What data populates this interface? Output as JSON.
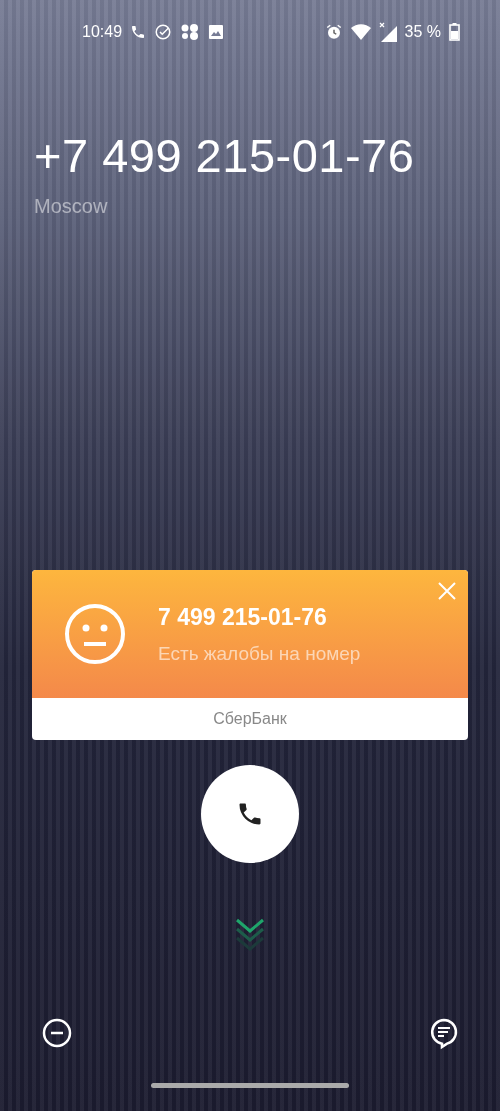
{
  "status_bar": {
    "time": "10:49",
    "battery": "35 %"
  },
  "caller": {
    "number": "+7 499 215-01-76",
    "location": "Moscow"
  },
  "caller_id_card": {
    "number": "7 499 215-01-76",
    "message": "Есть жалобы на номер",
    "provider": "СберБанк"
  }
}
